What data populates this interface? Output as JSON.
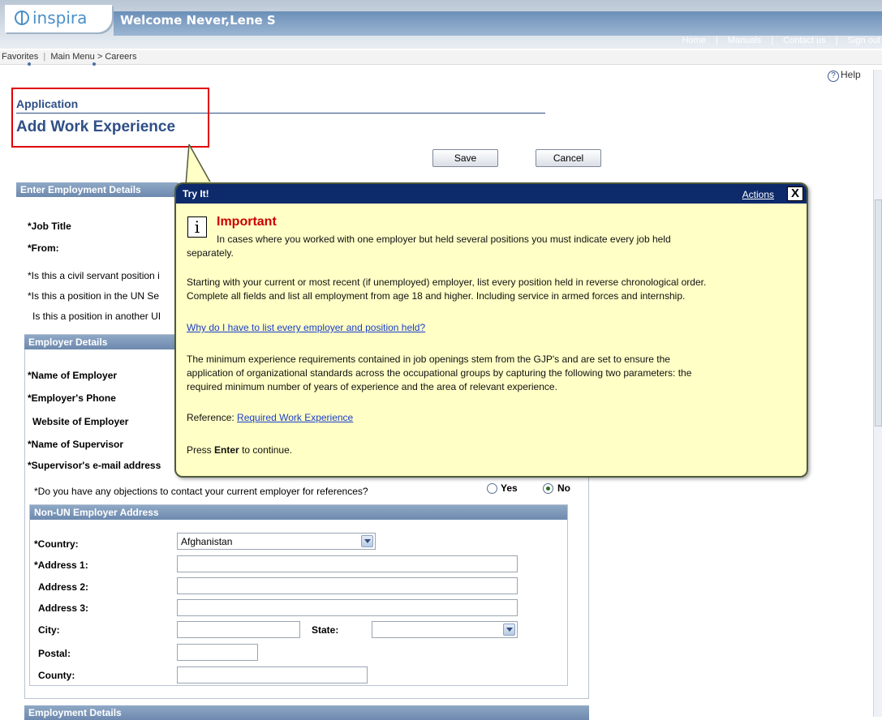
{
  "header": {
    "logo_text": "inspira",
    "welcome": "Welcome Never,Lene S",
    "links": [
      "Home",
      "Manuals",
      "Contact us",
      "Sign out"
    ]
  },
  "breadcrumb": {
    "favorites": "Favorites",
    "main_menu": "Main Menu",
    "separator": ">",
    "careers": "Careers"
  },
  "help": {
    "label": "Help",
    "icon_char": "?"
  },
  "page": {
    "section": "Application",
    "title": "Add Work Experience",
    "save_label": "Save",
    "cancel_label": "Cancel"
  },
  "employment_details": {
    "heading": "Enter Employment Details",
    "job_title_label": "*Job Title",
    "from_label": "*From:",
    "q_civil_servant": "*Is this a civil servant position i",
    "q_un_secretariat": "*Is this a position in the UN Se",
    "q_other_un": "Is this a position in another UI"
  },
  "employer_details": {
    "heading": "Employer Details",
    "name_label": "*Name of Employer",
    "phone_label": "*Employer's Phone",
    "website_label": "Website of Employer",
    "supervisor_label": "*Name of Supervisor",
    "supervisor_email_label": "*Supervisor's e-mail address",
    "objection_question": "*Do you have any objections to contact your current employer for references?",
    "yes_label": "Yes",
    "no_label": "No",
    "selected": "No"
  },
  "address": {
    "heading": "Non-UN Employer Address",
    "country_label": "*Country:",
    "country_value": "Afghanistan",
    "address1_label": "*Address 1:",
    "address2_label": "Address 2:",
    "address3_label": "Address 3:",
    "city_label": "City:",
    "state_label": "State:",
    "postal_label": "Postal:",
    "county_label": "County:"
  },
  "bottom_section": {
    "heading": "Employment Details"
  },
  "callout": {
    "title": "Try It!",
    "actions": "Actions",
    "close": "X",
    "info_char": "i",
    "important": "Important",
    "para1_line1": "In cases where you worked with one employer but held several positions you must indicate every job held",
    "para1_line2": "separately.",
    "para2_line1": "Starting with your current or most recent (if unemployed) employer, list every position held in reverse chronological order.",
    "para2_line2": "Complete all fields and list all employment from age 18 and higher. Including service in armed forces and internship.",
    "why_link": "Why do I have to list every employer and position held?",
    "para3_line1": "The minimum experience requirements contained in job openings stem from the GJP's and are set to ensure the",
    "para3_line2": "application of organizational standards across the occupational groups by capturing the following two parameters: the",
    "para3_line3": "required minimum number of years of experience and the area of relevant experience.",
    "reference_label": "Reference:",
    "reference_link": "Required Work Experience",
    "press": "Press",
    "enter": "Enter",
    "to_continue": "to continue."
  },
  "colors": {
    "highlight": "#e00000",
    "callout_bg": "#ffffc6",
    "callout_header": "#0d2a6b",
    "title_blue": "#2f4f86",
    "important_red": "#cc0000"
  }
}
